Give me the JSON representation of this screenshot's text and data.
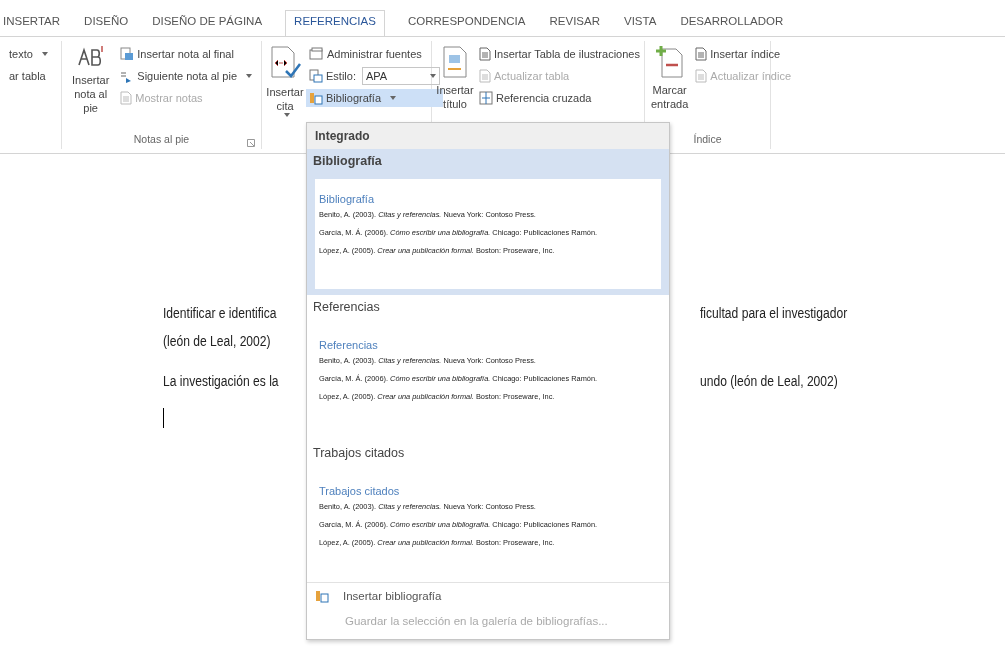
{
  "tabs": [
    {
      "label": "INSERTAR",
      "selected": false
    },
    {
      "label": "DISEÑO",
      "selected": false
    },
    {
      "label": "DISEÑO DE PÁGINA",
      "selected": false
    },
    {
      "label": "REFERENCIAS",
      "selected": true
    },
    {
      "label": "CORRESPONDENCIA",
      "selected": false
    },
    {
      "label": "REVISAR",
      "selected": false
    },
    {
      "label": "VISTA",
      "selected": false
    },
    {
      "label": "DESARROLLADOR",
      "selected": false
    }
  ],
  "ribbon": {
    "groups": [
      {
        "kind": "partial",
        "small": [
          {
            "label": "texto",
            "caret": true,
            "disabled": false
          },
          {
            "label": "ar tabla",
            "disabled": false
          }
        ]
      },
      {
        "kind": "footnotes",
        "label": "Notas al pie",
        "large": {
          "label": "Insertar nota al pie"
        },
        "small": [
          {
            "label": "Insertar nota al final",
            "disabled": false
          },
          {
            "label": "Siguiente nota al pie",
            "caret": true,
            "disabled": false
          },
          {
            "label": "Mostrar notas",
            "disabled": true
          }
        ]
      },
      {
        "kind": "citations",
        "large": {
          "label": "Insertar cita",
          "caret": true
        },
        "small": [
          {
            "label": "Administrar fuentes",
            "disabled": false
          },
          {
            "label": "Estilo:",
            "kind": "select",
            "value": "APA"
          },
          {
            "label": "Bibliografía",
            "caret": true,
            "disabled": false,
            "selected": true
          }
        ]
      },
      {
        "kind": "captions",
        "large": {
          "label": "Insertar título"
        },
        "small": [
          {
            "label": "Insertar Tabla de ilustraciones",
            "disabled": false
          },
          {
            "label": "Actualizar tabla",
            "disabled": true
          },
          {
            "label": "Referencia cruzada",
            "disabled": false
          }
        ]
      },
      {
        "kind": "index",
        "label": "Índice",
        "large": {
          "label": "Marcar entrada"
        },
        "small": [
          {
            "label": "Insertar índice",
            "disabled": false
          },
          {
            "label": "Actualizar índice",
            "disabled": true
          }
        ]
      }
    ]
  },
  "document": {
    "lines": [
      [
        "Identificar e identifica",
        "ficultad  para el investigador"
      ],
      [
        "(león de Leal, 2002)"
      ],
      [
        "La investigación es la",
        "undo (león de Leal, 2002)"
      ]
    ],
    "caret": true
  },
  "bibliography_menu": {
    "header": "Integrado",
    "gallery": [
      {
        "label": "Bibliografía",
        "selected": true,
        "title": "Bibliografía",
        "entries": [
          "Benito, A. (2003). *Citas y referencias.* Nueva York: Contoso Press.",
          "García, M. Á. (2006). *Cómo escribir una bibliografía.* Chicago: Publicaciones Ramón.",
          "López, A. (2005). *Crear una publicación formal.* Boston: Proseware, Inc."
        ]
      },
      {
        "label": "Referencias",
        "selected": false,
        "title": "Referencias",
        "entries": [
          "Benito, A. (2003). *Citas y referencias.* Nueva York: Contoso Press.",
          "García, M. Á. (2006). *Cómo escribir una bibliografía.* Chicago: Publicaciones Ramón.",
          "López, A. (2005). *Crear una publicación formal.* Boston: Proseware, Inc."
        ]
      },
      {
        "label": "Trabajos citados",
        "selected": false,
        "title": "Trabajos citados",
        "entries": [
          "Benito, A. (2003). *Citas y referencias.* Nueva York: Contoso Press.",
          "García, M. Á. (2006). *Cómo escribir una bibliografía.* Chicago: Publicaciones Ramón.",
          "López, A. (2005). *Crear una publicación formal.* Boston: Proseware, Inc."
        ]
      }
    ],
    "commands": [
      {
        "label": "Insertar bibliografía",
        "disabled": false
      },
      {
        "label": "Guardar la selección en la galería de bibliografías...",
        "disabled": true
      }
    ]
  }
}
